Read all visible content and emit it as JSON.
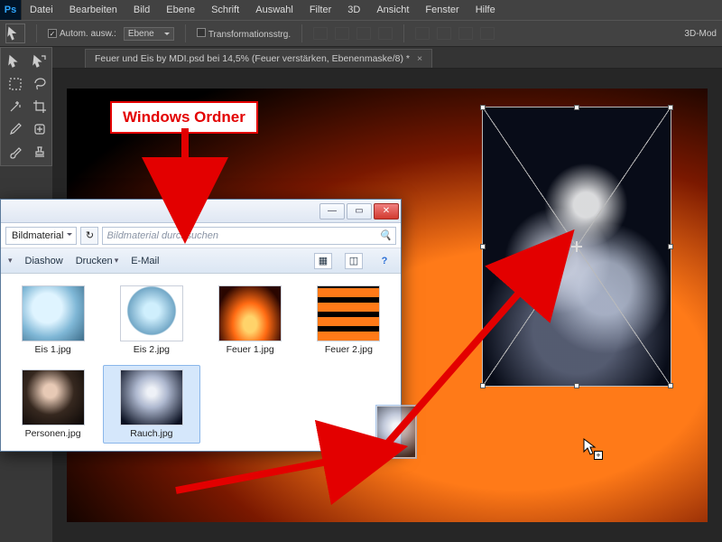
{
  "app": {
    "logo": "Ps"
  },
  "menu": [
    "Datei",
    "Bearbeiten",
    "Bild",
    "Ebene",
    "Schrift",
    "Auswahl",
    "Filter",
    "3D",
    "Ansicht",
    "Fenster",
    "Hilfe"
  ],
  "options": {
    "auto_select": {
      "checked": true,
      "label": "Autom. ausw.:"
    },
    "auto_select_target": "Ebene",
    "transform_ctrl": {
      "checked": false,
      "label": "Transformationsstrg."
    },
    "mode3d": "3D-Mod"
  },
  "tab": {
    "title": "Feuer und Eis by MDI.psd bei 14,5% (Feuer verstärken, Ebenenmaske/8) *"
  },
  "tools": [
    "move",
    "select-rect",
    "lasso",
    "wand",
    "crop",
    "eyedropper",
    "heal",
    "brush",
    "stamp",
    "history"
  ],
  "explorer": {
    "folder": "Bildmaterial",
    "search_placeholder": "Bildmaterial durchsuchen",
    "commands": [
      "Diashow",
      "Drucken",
      "E-Mail"
    ],
    "files": [
      {
        "name": "Eis 1.jpg",
        "thumb": "th-ice1",
        "selected": false
      },
      {
        "name": "Eis 2.jpg",
        "thumb": "th-ice2",
        "selected": false
      },
      {
        "name": "Feuer 1.jpg",
        "thumb": "th-fire1",
        "selected": false
      },
      {
        "name": "Feuer 2.jpg",
        "thumb": "th-fire2",
        "selected": false
      },
      {
        "name": "Personen.jpg",
        "thumb": "th-pers",
        "selected": false
      },
      {
        "name": "Rauch.jpg",
        "thumb": "th-smoke",
        "selected": true
      }
    ]
  },
  "annotation": {
    "label": "Windows Ordner"
  },
  "chart_data": null
}
